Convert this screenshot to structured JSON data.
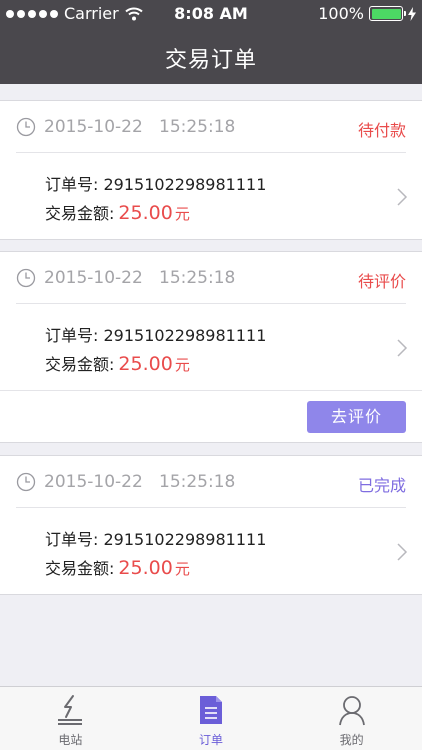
{
  "status_bar": {
    "carrier": "Carrier",
    "time": "8:08 AM",
    "battery": "100%"
  },
  "nav": {
    "title": "交易订单"
  },
  "orders": [
    {
      "time": "2015-10-22   15:25:18",
      "status": "待付款",
      "order_no_label": "订单号:",
      "order_no": "2915102298981111",
      "amount_label": "交易金额:",
      "amount": "25.00",
      "unit": "元"
    },
    {
      "time": "2015-10-22   15:25:18",
      "status": "待评价",
      "order_no_label": "订单号:",
      "order_no": "2915102298981111",
      "amount_label": "交易金额:",
      "amount": "25.00",
      "unit": "元",
      "action": "去评价"
    },
    {
      "time": "2015-10-22   15:25:18",
      "status": "已完成",
      "order_no_label": "订单号:",
      "order_no": "2915102298981111",
      "amount_label": "交易金额:",
      "amount": "25.00",
      "unit": "元"
    }
  ],
  "tabs": [
    {
      "label": "电站",
      "icon": "power-station-icon"
    },
    {
      "label": "订单",
      "icon": "order-document-icon"
    },
    {
      "label": "我的",
      "icon": "user-profile-icon"
    }
  ],
  "colors": {
    "header": "#4a484d",
    "accent": "#7f6de0",
    "price": "#e94c4c",
    "button": "#8f86ea"
  }
}
